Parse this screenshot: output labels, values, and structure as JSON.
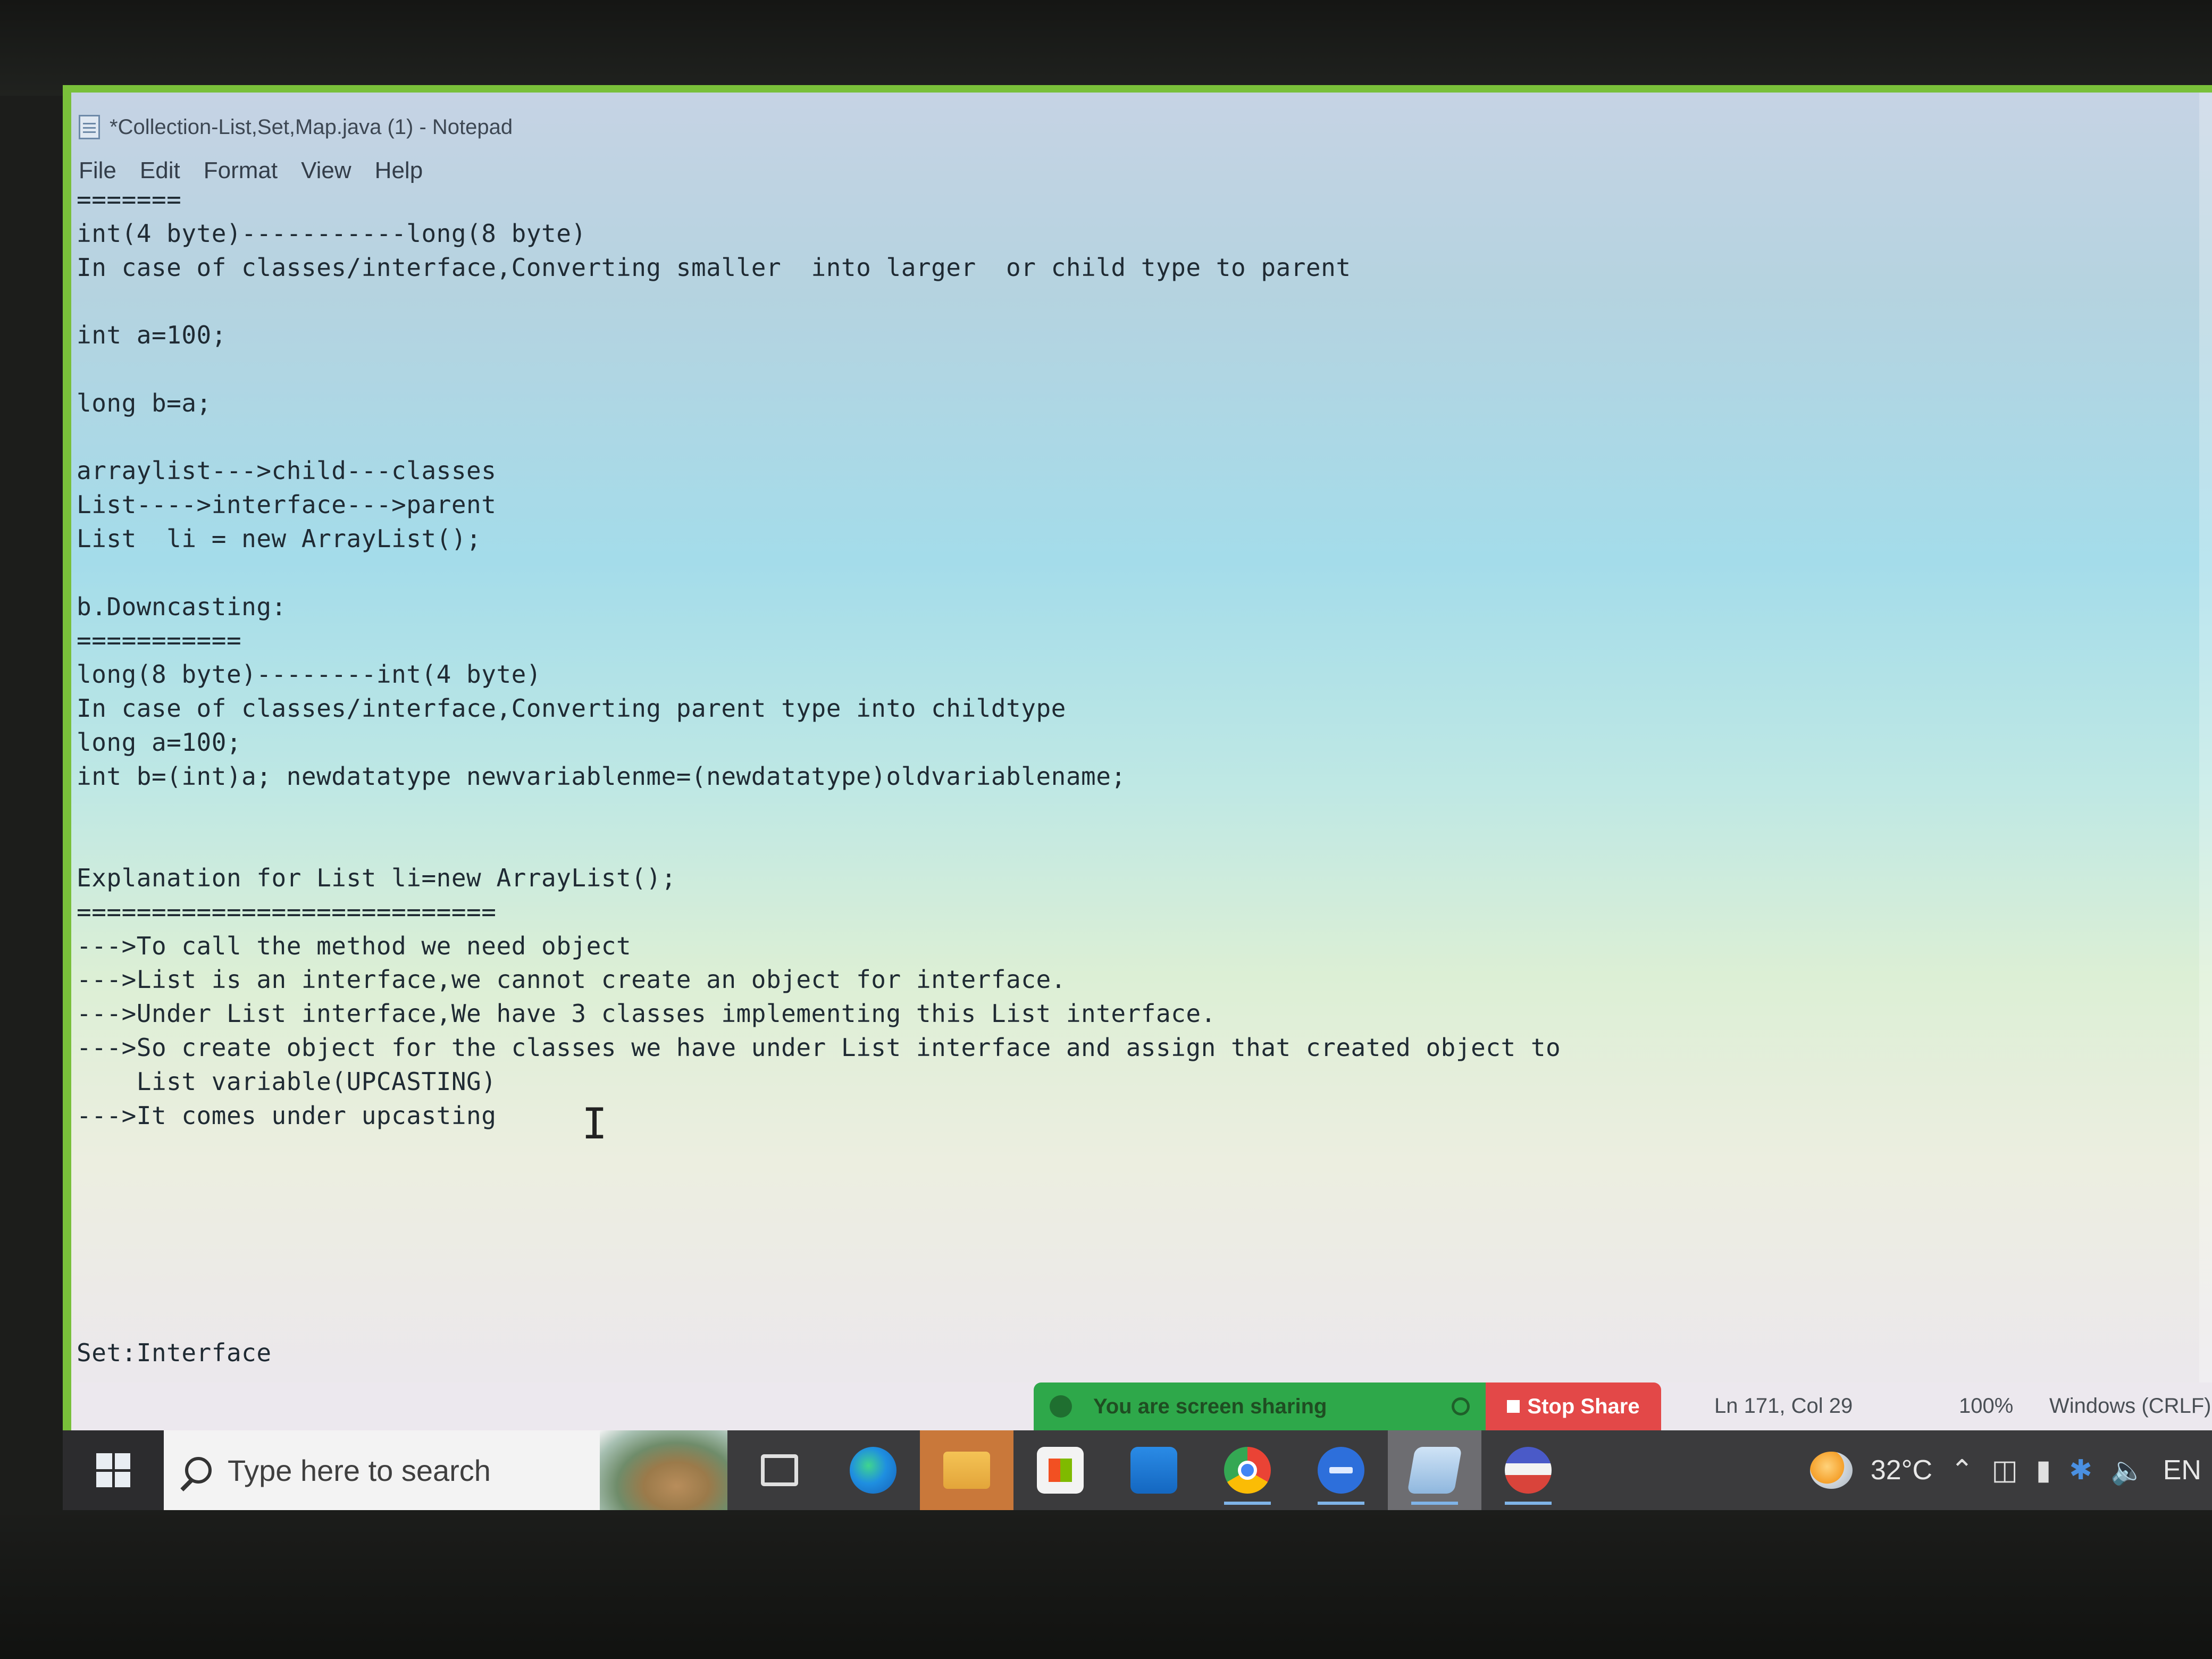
{
  "window": {
    "title": "*Collection-List,Set,Map.java (1) - Notepad",
    "menu": [
      "File",
      "Edit",
      "Format",
      "View",
      "Help"
    ]
  },
  "editor": {
    "lines": [
      "=======",
      "int(4 byte)-----------long(8 byte)",
      "In case of classes/interface,Converting smaller  into larger  or child type to parent",
      "",
      "int a=100;",
      "",
      "long b=a;",
      "",
      "arraylist--->child---classes",
      "List---->interface--->parent",
      "List  li = new ArrayList();",
      "",
      "b.Downcasting:",
      "===========",
      "long(8 byte)--------int(4 byte)",
      "In case of classes/interface,Converting parent type into childtype",
      "long a=100;",
      "int b=(int)a; newdatatype newvariablenme=(newdatatype)oldvariablename;",
      "",
      "",
      "Explanation for List li=new ArrayList();",
      "============================",
      "--->To call the method we need object",
      "--->List is an interface,we cannot create an object for interface.",
      "--->Under List interface,We have 3 classes implementing this List interface.",
      "--->So create object for the classes we have under List interface and assign that created object to",
      "    List variable(UPCASTING)",
      "--->It comes under upcasting",
      "",
      "",
      "",
      "",
      "",
      "",
      "Set:Interface"
    ]
  },
  "status_bar": {
    "screen_share_text": "You are screen sharing",
    "stop_share_label": "Stop Share",
    "position": "Ln 171, Col 29",
    "zoom": "100%",
    "line_ending": "Windows (CRLF)"
  },
  "taskbar": {
    "search_placeholder": "Type here to search",
    "apps": [
      "task-view",
      "edge",
      "file-explorer",
      "microsoft-store",
      "mail",
      "chrome",
      "zoom",
      "notepad",
      "app"
    ],
    "weather_temp": "32°C",
    "language": "EN"
  }
}
